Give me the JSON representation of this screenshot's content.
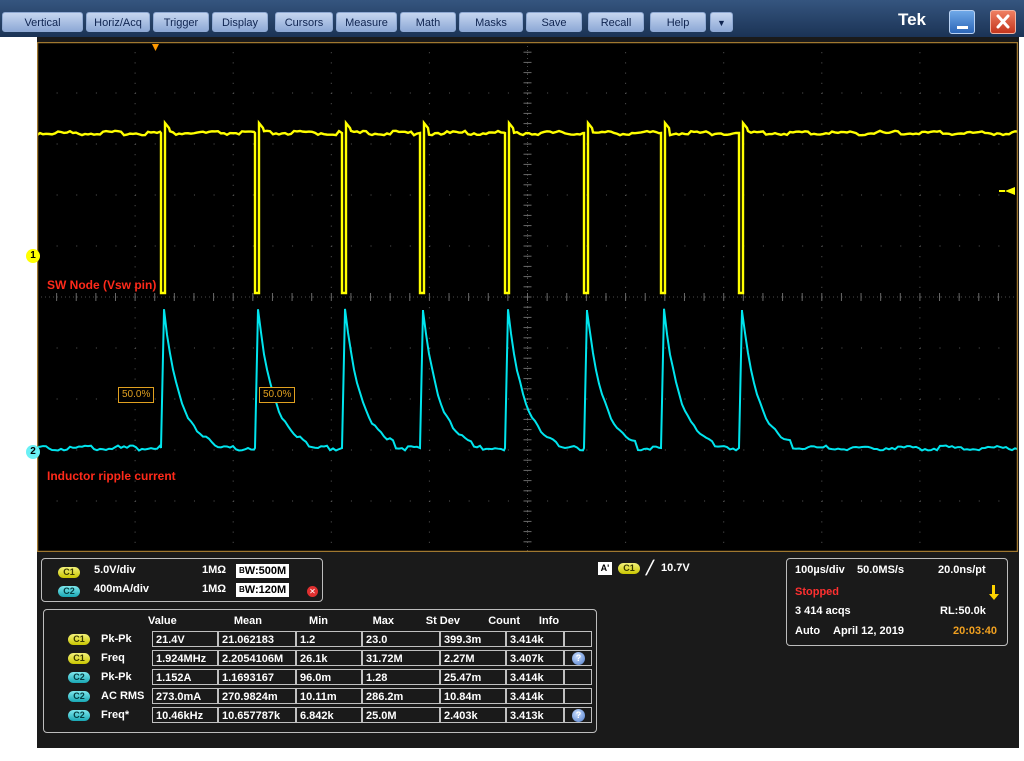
{
  "menu": {
    "items": [
      "Vertical",
      "Horiz/Acq",
      "Trigger",
      "Display",
      "Cursors",
      "Measure",
      "Math",
      "Masks",
      "Save",
      "Recall",
      "Help"
    ],
    "dropdown_glyph": "▼",
    "brand": "Tek"
  },
  "waveform": {
    "ch1_label": "SW Node (Vsw pin)",
    "ch2_label": "Inductor ripple current",
    "ch1_marker": "1",
    "ch2_marker": "2",
    "ref_flag_1": "50.0%",
    "ref_flag_2": "50.0%",
    "colors": {
      "ch1": "#ffff00",
      "ch2": "#00e5ee",
      "grid": "#5a5a5a",
      "frame": "#a07830"
    }
  },
  "channels": [
    {
      "chip": "C1",
      "scale": "5.0V/div",
      "impedance": "1MΩ",
      "bw_prefix": "B",
      "bw": "W:500M",
      "color": "yellow"
    },
    {
      "chip": "C2",
      "scale": "400mA/div",
      "impedance": "1MΩ",
      "bw_prefix": "B",
      "bw": "W:120M",
      "color": "cyan"
    }
  ],
  "trigger": {
    "label": "A'",
    "source": "C1",
    "slope": "╱",
    "level": "10.7V"
  },
  "acquisition": {
    "timebase": "100µs/div",
    "sample_rate": "50.0MS/s",
    "resolution": "20.0ns/pt",
    "status": "Stopped",
    "acqs": "3 414 acqs",
    "record_length": "RL:50.0k",
    "mode": "Auto",
    "date": "April 12, 2019",
    "time": "20:03:40"
  },
  "measurements": {
    "headers": [
      "Value",
      "Mean",
      "Min",
      "Max",
      "St Dev",
      "Count",
      "Info"
    ],
    "rows": [
      {
        "chip": "C1",
        "color": "yellow",
        "name": "Pk-Pk",
        "value": "21.4V",
        "mean": "21.062183",
        "min": "1.2",
        "max": "23.0",
        "stdev": "399.3m",
        "count": "3.414k",
        "info": ""
      },
      {
        "chip": "C1",
        "color": "yellow",
        "name": "Freq",
        "value": "1.924MHz",
        "mean": "2.2054106M",
        "min": "26.1k",
        "max": "31.72M",
        "stdev": "2.27M",
        "count": "3.407k",
        "info": "?"
      },
      {
        "chip": "C2",
        "color": "cyan",
        "name": "Pk-Pk",
        "value": "1.152A",
        "mean": "1.1693167",
        "min": "96.0m",
        "max": "1.28",
        "stdev": "25.47m",
        "count": "3.414k",
        "info": ""
      },
      {
        "chip": "C2",
        "color": "cyan",
        "name": "AC RMS",
        "value": "273.0mA",
        "mean": "270.9824m",
        "min": "10.11m",
        "max": "286.2m",
        "stdev": "10.84m",
        "count": "3.414k",
        "info": ""
      },
      {
        "chip": "C2",
        "color": "cyan",
        "name": "Freq*",
        "value": "10.46kHz",
        "mean": "10.657787k",
        "min": "6.842k",
        "max": "25.0M",
        "stdev": "2.403k",
        "count": "3.413k",
        "info": "?"
      }
    ]
  }
}
